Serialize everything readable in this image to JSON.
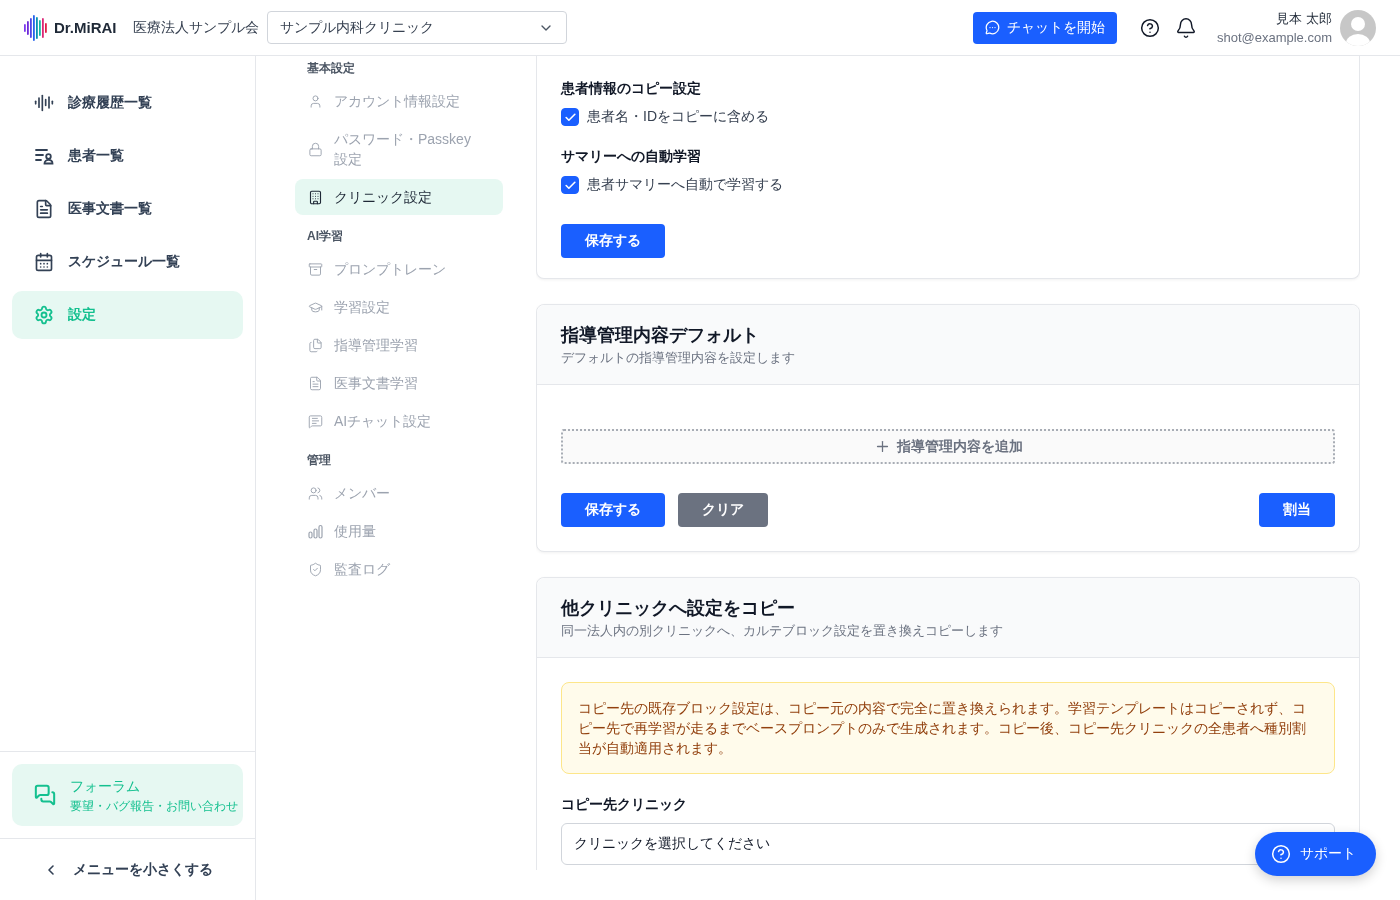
{
  "header": {
    "logo": "Dr.MiRAI",
    "organization": "医療法人サンプル会",
    "clinic_select": {
      "value": "サンプル内科クリニック"
    },
    "chat_button": "チャットを開始",
    "user": {
      "name": "見本 太郎",
      "email": "shot@example.com"
    }
  },
  "sidebar": {
    "items": [
      {
        "label": "診療履歴一覧",
        "selected": false
      },
      {
        "label": "患者一覧",
        "selected": false
      },
      {
        "label": "医事文書一覧",
        "selected": false
      },
      {
        "label": "スケジュール一覧",
        "selected": false
      },
      {
        "label": "設定",
        "selected": true
      }
    ],
    "forum": {
      "title": "フォーラム",
      "subtitle": "要望・バグ報告・お問い合わせ"
    },
    "collapse_button": "メニューを小さくする"
  },
  "settings_nav": {
    "sections": [
      {
        "title": "基本設定",
        "items": [
          {
            "label": "アカウント情報設定",
            "selected": false
          },
          {
            "label": "パスワード・Passkey設定",
            "selected": false
          },
          {
            "label": "クリニック設定",
            "selected": true
          }
        ]
      },
      {
        "title": "AI学習",
        "items": [
          {
            "label": "プロンプトレーン",
            "selected": false
          },
          {
            "label": "学習設定",
            "selected": false
          },
          {
            "label": "指導管理学習",
            "selected": false
          },
          {
            "label": "医事文書学習",
            "selected": false
          },
          {
            "label": "AIチャット設定",
            "selected": false
          }
        ]
      },
      {
        "title": "管理",
        "items": [
          {
            "label": "メンバー",
            "selected": false
          },
          {
            "label": "使用量",
            "selected": false
          },
          {
            "label": "監査ログ",
            "selected": false
          }
        ]
      }
    ]
  },
  "main": {
    "copy_settings_card": {
      "groups": [
        {
          "title": "患者情報のコピー設定",
          "option": {
            "label": "患者名・IDをコピーに含める",
            "checked": true
          }
        },
        {
          "title": "サマリーへの自動学習",
          "option": {
            "label": "患者サマリーへ自動で学習する",
            "checked": true
          }
        }
      ],
      "save_button": "保存する"
    },
    "guidance_card": {
      "title": "指導管理内容デフォルト",
      "subtitle": "デフォルトの指導管理内容を設定します",
      "add_button": "指導管理内容を追加",
      "buttons": [
        {
          "label": "保存する",
          "kind": "primary"
        },
        {
          "label": "クリア",
          "kind": "secondary"
        }
      ],
      "assign_button": "割当"
    },
    "clinic_copy_card": {
      "title": "他クリニックへ設定をコピー",
      "subtitle": "同一法人内の別クリニックへ、カルテブロック設定を置き換えコピーします",
      "warning": "コピー先の既存ブロック設定は、コピー元の内容で完全に置き換えられます。学習テンプレートはコピーされず、コピー先で再学習が走るまでベースプロンプトのみで生成されます。コピー後、コピー先クリニックの全患者へ種別割当が自動適用されます。",
      "target_label": "コピー先クリニック",
      "target_select": {
        "value": "クリニックを選択してください"
      }
    }
  },
  "support_button": "サポート"
}
